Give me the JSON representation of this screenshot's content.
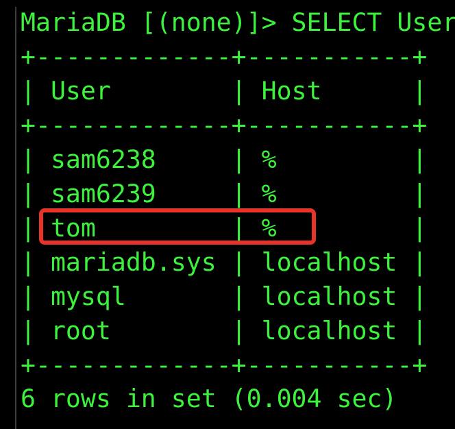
{
  "prompt": "MariaDB [(none)]> SELECT User",
  "table": {
    "border": "+-------------+-----------+",
    "columns": [
      "User",
      "Host"
    ],
    "header_line": "| User        | Host      |",
    "rows": [
      {
        "user": "sam6238",
        "host": "%",
        "line": "| sam6238     | %         |"
      },
      {
        "user": "sam6239",
        "host": "%",
        "line": "| sam6239     | %         |"
      },
      {
        "user": "tom",
        "host": "%",
        "line": "| tom         | %         |"
      },
      {
        "user": "mariadb.sys",
        "host": "localhost",
        "line": "| mariadb.sys | localhost |"
      },
      {
        "user": "mysql",
        "host": "localhost",
        "line": "| mysql       | localhost |"
      },
      {
        "user": "root",
        "host": "localhost",
        "line": "| root        | localhost |"
      }
    ]
  },
  "summary": "6 rows in set (0.004 sec)",
  "colors": {
    "background": "#000000",
    "text": "#3cf23c",
    "highlight": "#e8332a"
  }
}
